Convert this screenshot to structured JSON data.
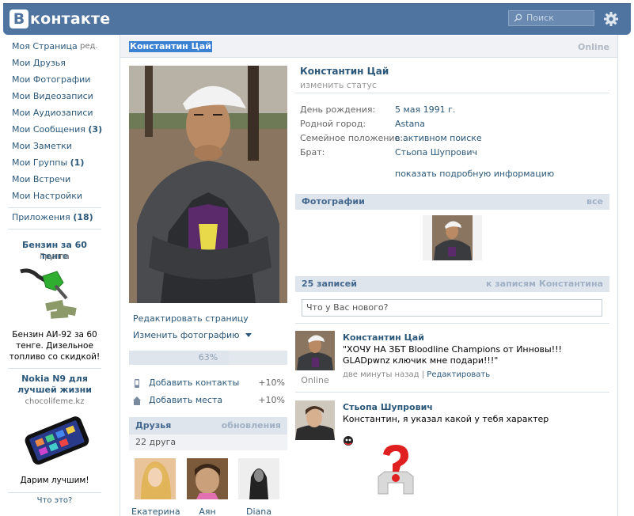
{
  "header": {
    "logo_letter": "В",
    "logo_text": "контакте",
    "search_placeholder": "Поиск"
  },
  "nav": {
    "items": [
      {
        "label": "Моя Страница",
        "extra": "ред."
      },
      {
        "label": "Мои Друзья"
      },
      {
        "label": "Мои Фотографии"
      },
      {
        "label": "Мои Видеозаписи"
      },
      {
        "label": "Мои Аудиозаписи"
      },
      {
        "label": "Мои Сообщения",
        "count": "(3)"
      },
      {
        "label": "Мои Заметки"
      },
      {
        "label": "Мои Группы",
        "count": "(1)"
      },
      {
        "label": "Мои Встречи"
      },
      {
        "label": "Мои Настройки"
      }
    ],
    "apps": {
      "label": "Приложения",
      "count": "(18)"
    },
    "ad1": {
      "title": "Бензин за 60 тенге",
      "sub": "Группа",
      "text": "Бензин АИ-92 за 60 тенге. Дизельное топливо со скидкой!"
    },
    "ad2": {
      "title": "Nokia N9 для лучшей жизни",
      "sub": "chocolifeme.kz",
      "text": "Дарим лучшим!"
    },
    "what": "Что это?"
  },
  "page": {
    "title": "Константин Цай",
    "online": "Online"
  },
  "left_col": {
    "edit_page": "Редактировать страницу",
    "change_photo": "Изменить фотографию",
    "progress_label": "63%",
    "progress_value": 0.63,
    "add_contacts": "Добавить контакты",
    "add_contacts_pct": "+10%",
    "add_places": "Добавить места",
    "add_places_pct": "+10%",
    "friends_title": "Друзья",
    "friends_updates": "обновления",
    "friends_count": "22 друга",
    "friends": [
      {
        "name": "Екатерина"
      },
      {
        "name": "Аян"
      },
      {
        "name": "Diana"
      }
    ]
  },
  "profile": {
    "name": "Константин Цай",
    "status": "изменить статус",
    "info": [
      {
        "label": "День рождения:",
        "value": "5 мая 1991 г."
      },
      {
        "label": "Родной город:",
        "value": "Astana"
      },
      {
        "label": "Семейное положение:",
        "value": "в активном поиске"
      },
      {
        "label": "Брат:",
        "value": "Стьопа Шупрович"
      }
    ],
    "more_info": "показать подробную информацию"
  },
  "photos": {
    "title": "Фотографии",
    "all": "все"
  },
  "wall": {
    "title": "25 записей",
    "to_posts": "к записям Константина",
    "input_placeholder": "Что у Вас нового?",
    "posts": [
      {
        "author": "Константин Цай",
        "text": "\"ХОЧУ НА ЗБТ Bloodline Champions от Инновы!!! GLADpwnz ключик мне подари!!!\"",
        "time": "две минуты назад",
        "edit": "Редактировать",
        "status": "Online"
      },
      {
        "author": "Стьопа Шупрович",
        "text": "Константин, я указал какой у тебя характер"
      }
    ]
  },
  "colors": {
    "header": "#4f74a0",
    "link": "#2b587a",
    "section": "#dfe5ec"
  }
}
